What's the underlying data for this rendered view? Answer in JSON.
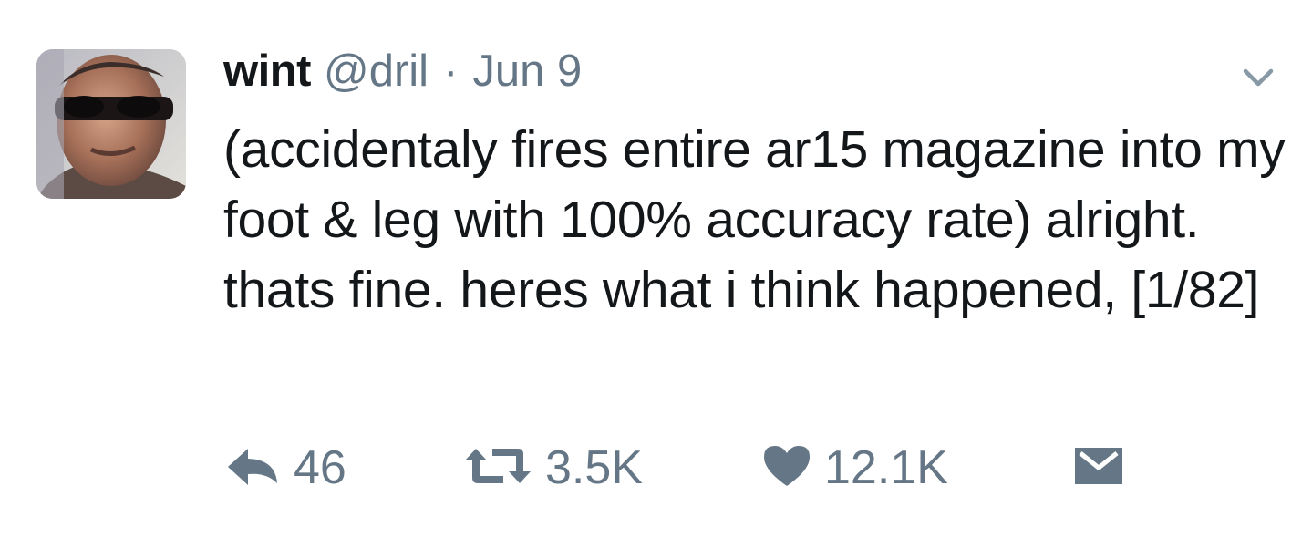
{
  "tweet": {
    "author_name": "wint",
    "handle": "@dril",
    "separator": "·",
    "date": "Jun 9",
    "text": "(accidentaly fires entire ar15 magazine into my foot & leg with 100% accuracy rate) alright. thats fine. heres what i think happened, [1/82]"
  },
  "actions": {
    "replies": "46",
    "retweets": "3.5K",
    "likes": "12.1K"
  },
  "icons": {
    "reply": "reply-icon",
    "retweet": "retweet-icon",
    "like": "heart-icon",
    "dm": "envelope-icon",
    "caret": "chevron-down-icon"
  },
  "colors": {
    "text": "#14171a",
    "muted": "#657786",
    "background": "#ffffff"
  }
}
